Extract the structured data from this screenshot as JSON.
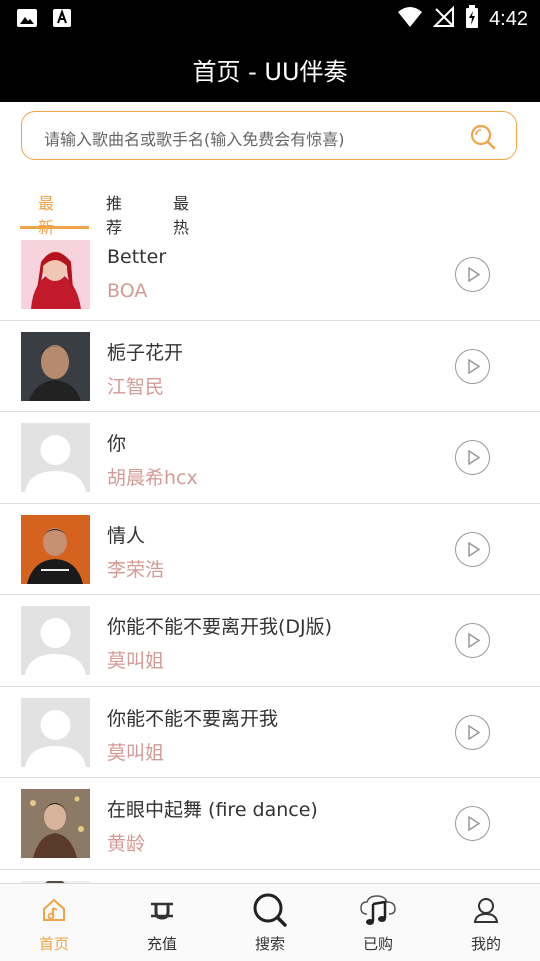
{
  "status": {
    "time": "4:42"
  },
  "header": {
    "title": "首页 - UU伴奏"
  },
  "search": {
    "placeholder": "请输入歌曲名或歌手名(输入免费会有惊喜)"
  },
  "tabs": [
    {
      "label": "最新",
      "active": true
    },
    {
      "label": "推荐"
    },
    {
      "label": "最热"
    }
  ],
  "songs": [
    {
      "title": "Better",
      "artist": "BOA",
      "thumb": "photo-red"
    },
    {
      "title": "栀子花开",
      "artist": "江智民",
      "thumb": "photo-man"
    },
    {
      "title": "你",
      "artist": "胡晨希hcx",
      "thumb": "placeholder"
    },
    {
      "title": "情人",
      "artist": "李荣浩",
      "thumb": "photo-orange"
    },
    {
      "title": "你能不能不要离开我(DJ版)",
      "artist": "莫叫姐",
      "thumb": "placeholder"
    },
    {
      "title": "你能不能不要离开我",
      "artist": "莫叫姐",
      "thumb": "placeholder"
    },
    {
      "title": "在眼中起舞 (fire dance)",
      "artist": "黄龄",
      "thumb": "photo-dancer"
    }
  ],
  "bottom_nav": [
    {
      "label": "首页",
      "icon": "home-icon",
      "active": true
    },
    {
      "label": "充值",
      "icon": "recharge-icon"
    },
    {
      "label": "搜索",
      "icon": "search-icon"
    },
    {
      "label": "已购",
      "icon": "music-cloud-icon"
    },
    {
      "label": "我的",
      "icon": "user-icon"
    }
  ],
  "colors": {
    "accent": "#f0a347",
    "artist": "#d49a95",
    "bar": "#000000"
  }
}
